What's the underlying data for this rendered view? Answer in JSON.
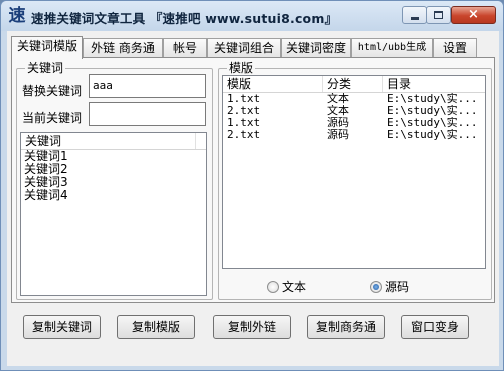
{
  "window": {
    "title": "速推关键词文章工具 『速推吧 www.sutui8.com』",
    "icon_glyph": "速",
    "controls": {
      "minimize": "minimize-icon",
      "maximize": "maximize-icon",
      "close": "×"
    }
  },
  "tabs": [
    {
      "label": "关键词模版",
      "active": true
    },
    {
      "label": "外链 商务通",
      "active": false
    },
    {
      "label": "帐号",
      "active": false
    },
    {
      "label": "关键词组合",
      "active": false
    },
    {
      "label": "关键词密度",
      "active": false
    },
    {
      "label": "html/ubb生成",
      "active": false
    },
    {
      "label": "设置",
      "active": false
    }
  ],
  "keyword_group": {
    "legend": "关键词",
    "replace_label": "替换关键词",
    "replace_value": "aaa",
    "current_label": "当前关键词",
    "current_value": "",
    "list_header": "关键词",
    "items": [
      "关键词1",
      "关键词2",
      "关键词3",
      "关键词4"
    ]
  },
  "template_group": {
    "legend": "模版",
    "columns": [
      "模版",
      "分类",
      "目录"
    ],
    "rows": [
      {
        "file": "1.txt",
        "category": "文本",
        "dir": "E:\\study\\实..."
      },
      {
        "file": "2.txt",
        "category": "文本",
        "dir": "E:\\study\\实..."
      },
      {
        "file": "1.txt",
        "category": "源码",
        "dir": "E:\\study\\实..."
      },
      {
        "file": "2.txt",
        "category": "源码",
        "dir": "E:\\study\\实..."
      }
    ],
    "radio_text": "文本",
    "radio_source": "源码",
    "selected": "源码"
  },
  "buttons": {
    "copy_keywords": "复制关键词",
    "copy_template": "复制模版",
    "copy_external": "复制外链",
    "copy_business": "复制商务通",
    "window_transform": "窗口变身"
  }
}
